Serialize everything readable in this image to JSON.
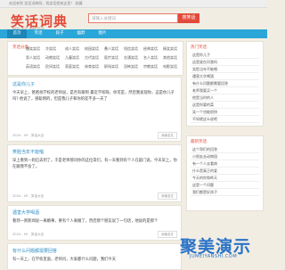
{
  "topbar": {
    "text": "欢迎来到 笑话词典网，找笑话就来这里！ 收藏"
  },
  "logo": {
    "title": "笑话词典",
    "subtitle": "搞笑 笑话 幽默 段子"
  },
  "search": {
    "placeholder": "请输入关键词",
    "button": "搜笑话"
  },
  "nav": {
    "tabs": [
      "首页",
      "笑话",
      "段子",
      "幽默",
      "图片"
    ]
  },
  "categories": {
    "header": "笑话分类",
    "rows": [
      [
        "爆笑笑话",
        "冷笑话",
        "成人笑话",
        "校园笑话",
        "愚人笑话",
        "短信笑话",
        "经典笑话",
        "搞笑笑话"
      ],
      [
        "男人笑话",
        "动物笑话",
        "儿童笑话",
        "古代笑话",
        "医疗笑话",
        "交通笑话",
        "名人笑话",
        "其他笑话"
      ],
      [
        "英语笑话",
        "民间笑话",
        "家庭笑话",
        "体育笑话",
        "职场笑话",
        "恐怖笑话",
        "宗教笑话",
        "电影笑话"
      ]
    ]
  },
  "cards": [
    {
      "title": "这是你儿子",
      "body": "今天早上，爸爸找学校的老师说，是否有聊到 最近学校呀，你可是，然后我发现你，这是你儿子吗? 他说了，很聪明的，但是我儿子和你的差不多一天了",
      "meta": "2024 - 09 - 笑话大全",
      "more": "阅读全文"
    },
    {
      "title": "笑脸当年不能唱",
      "body": "早上看到一则已去到了。于是老师那问你的这位哥们，有一天看到有个人在敲门说，今天早上，你在跟我不会了。",
      "meta": "2024 - 09 - 笑话大全",
      "more": "阅读全文"
    },
    {
      "title": "遇害大学喝酒",
      "body": "看到一则新闻说一离婚事，要有个人离婚了，然后那个朋友说了一句话，他说的是那个",
      "meta": "2024 - 09 - 笑话大全",
      "more": "阅读全文"
    },
    {
      "title": "有什么问题都需要回答",
      "body": "有一天上，在学校里面，老师问，大家都什么问题，我们今天",
      "meta": "",
      "more": ""
    }
  ],
  "sidebar": [
    {
      "header": "热门笑话",
      "items": [
        "这是你儿子",
        "这是谁在问我吗",
        "笑脸当年不能唱",
        "遇害大学喝酒",
        "有什么问题都需要回答",
        "老师我要买一个",
        "他是当时的人",
        "这是你要的菜",
        "笑一个也能很快",
        "不如就这么说吧"
      ]
    },
    {
      "header": "最新笑话",
      "items": [
        "这个哥们的回答",
        "小朋友去动物园",
        "有一个人去看病",
        "什么是真正的爱",
        "今天的你和昨天",
        "这是一个问题",
        "我们都是好孩子"
      ]
    }
  ],
  "watermark": {
    "cn": "聚美演示",
    "en": "JUMEIYANSHI.COM"
  }
}
